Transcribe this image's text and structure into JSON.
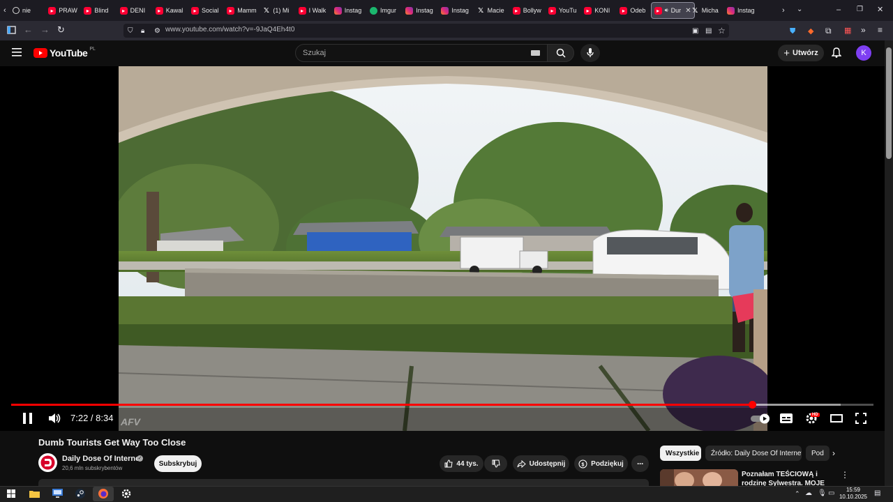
{
  "browser": {
    "tabs": [
      {
        "label": "nie",
        "icon": "generic"
      },
      {
        "label": "PRAW",
        "icon": "youtube"
      },
      {
        "label": "Blind",
        "icon": "youtube"
      },
      {
        "label": "DENI",
        "icon": "youtube"
      },
      {
        "label": "Kawal",
        "icon": "youtube"
      },
      {
        "label": "Social",
        "icon": "youtube"
      },
      {
        "label": "Mamm",
        "icon": "youtube"
      },
      {
        "label": "(1) Mi",
        "icon": "x"
      },
      {
        "label": "I Walk",
        "icon": "youtube"
      },
      {
        "label": "Instag",
        "icon": "instagram"
      },
      {
        "label": "Imgur",
        "icon": "imgur"
      },
      {
        "label": "Instag",
        "icon": "instagram"
      },
      {
        "label": "Instag",
        "icon": "instagram"
      },
      {
        "label": "Macie",
        "icon": "x"
      },
      {
        "label": "Bollyw",
        "icon": "youtube"
      },
      {
        "label": "YouTu",
        "icon": "youtube"
      },
      {
        "label": "KONI",
        "icon": "youtube"
      },
      {
        "label": "Odeb",
        "icon": "youtube"
      },
      {
        "label": "Dur",
        "icon": "youtube",
        "active": true
      },
      {
        "label": "Micha",
        "icon": "x"
      },
      {
        "label": "Instag",
        "icon": "instagram"
      }
    ],
    "url": "www.youtube.com/watch?v=-9JaQ4Eh4t0"
  },
  "youtube": {
    "logo_text": "YouTube",
    "region": "PL",
    "search_placeholder": "Szukaj",
    "create_label": "Utwórz",
    "avatar_letter": "K"
  },
  "player": {
    "current_time": "7:22",
    "duration": "8:34",
    "timecode": "7:22 / 8:34",
    "watermark": "AFV",
    "progress": 0.86,
    "buffered": 0.962,
    "hd_badge": "HD"
  },
  "video_info": {
    "title": "Dumb Tourists Get Way Too Close",
    "channel_name": "Daily Dose Of Internet",
    "subscribers": "20,6 mln subskrybentów",
    "subscribe_label": "Subskrybuj",
    "likes": "44 tys.",
    "share_label": "Udostępnij",
    "thanks_label": "Podziękuj"
  },
  "sidebar": {
    "chips": [
      "Wszystkie",
      "Źródło: Daily Dose Of Internet",
      "Pod"
    ],
    "rec_title": "Poznałam TEŚCIOWĄ i rodzinę Sylwestra. MOJE URODZINY |"
  },
  "taskbar": {
    "time": "15:59",
    "date": "10.10.2025"
  },
  "colors": {
    "accent": "#ff0000",
    "background": "#0f0f0f",
    "avatar": "#7e3ff2"
  }
}
